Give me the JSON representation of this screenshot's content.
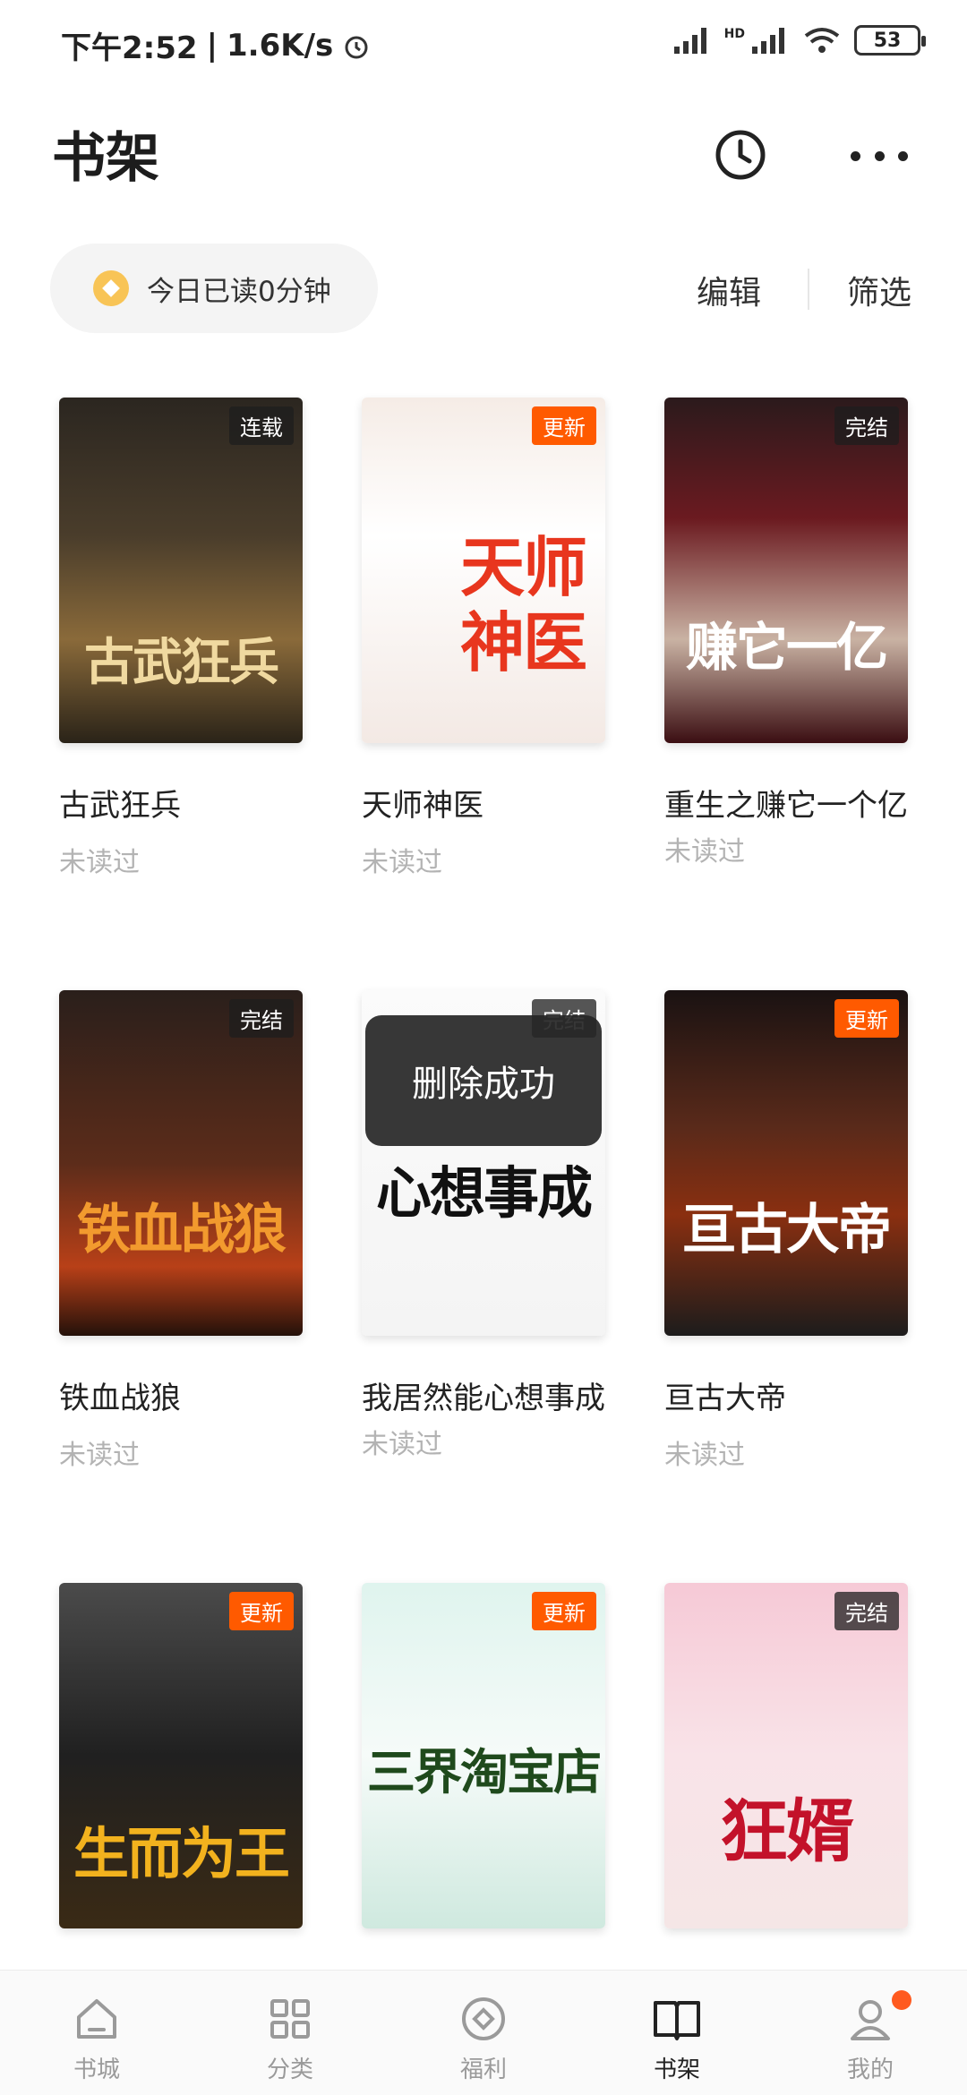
{
  "status_bar": {
    "time": "下午2:52",
    "speed": "1.6K/s",
    "alarm_icon": "alarm-clock-icon",
    "network": "HD",
    "battery": "53"
  },
  "header": {
    "title": "书架",
    "history_icon": "clock-icon",
    "more_icon": "more-dots-icon"
  },
  "toolbar": {
    "reading_time": "今日已读0分钟",
    "edit_label": "编辑",
    "filter_label": "筛选"
  },
  "books": [
    {
      "title": "古武狂兵",
      "status": "未读过",
      "badge": "连载",
      "cover_text": "古武狂兵"
    },
    {
      "title": "天师神医",
      "status": "未读过",
      "badge": "更新",
      "cover_text": "天师神医"
    },
    {
      "title": "重生之赚它一个亿",
      "status": "未读过",
      "badge": "完结",
      "cover_text": "赚它一亿"
    },
    {
      "title": "铁血战狼",
      "status": "未读过",
      "badge": "完结",
      "cover_text": "铁血战狼"
    },
    {
      "title": "我居然能心想事成",
      "status": "未读过",
      "badge": "完结",
      "cover_text": "心想事成"
    },
    {
      "title": "亘古大帝",
      "status": "未读过",
      "badge": "更新",
      "cover_text": "亘古大帝"
    },
    {
      "title": "生而为王",
      "status": "",
      "badge": "更新",
      "cover_text": "生而为王"
    },
    {
      "title": "三界淘宝店",
      "status": "",
      "badge": "更新",
      "cover_text": "三界淘宝店"
    },
    {
      "title": "狂婿",
      "status": "",
      "badge": "完结",
      "cover_text": "狂婿"
    }
  ],
  "toast": "删除成功",
  "nav": [
    {
      "label": "书城",
      "icon": "home-icon"
    },
    {
      "label": "分类",
      "icon": "grid-icon"
    },
    {
      "label": "福利",
      "icon": "gift-icon"
    },
    {
      "label": "书架",
      "icon": "book-icon",
      "active": true
    },
    {
      "label": "我的",
      "icon": "user-icon"
    }
  ],
  "colors": {
    "accent": "#ff5a00",
    "badge_dark": "#1e1e1e",
    "muted": "#b3b3b3"
  }
}
